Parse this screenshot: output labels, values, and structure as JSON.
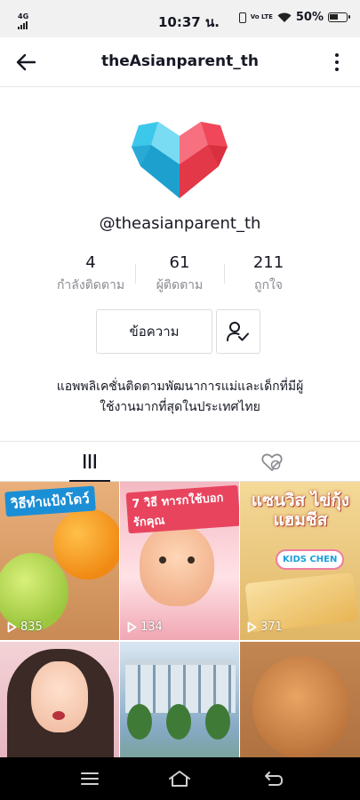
{
  "status_bar": {
    "network": "4G",
    "time": "10:37 น.",
    "volte": "Vo LTE",
    "battery": "50%"
  },
  "header": {
    "title": "theAsianparent_th",
    "back_icon": "arrow-left-icon",
    "more_icon": "more-vertical-icon"
  },
  "profile": {
    "avatar_icon": "heart-logo-icon",
    "avatar_colors": {
      "left": "#3cc8ea",
      "right": "#f0475a"
    },
    "username": "@theasianparent_th",
    "stats": [
      {
        "value": "4",
        "label": "กำลังติดตาม"
      },
      {
        "value": "61",
        "label": "ผู้ติดตาม"
      },
      {
        "value": "211",
        "label": "ถูกใจ"
      }
    ],
    "message_button": "ข้อความ",
    "follow_icon": "user-check-icon",
    "bio_line1": "แอพพลิเคชั่นติดตามพัฒนาการแม่และเด็กที่มีผู้",
    "bio_line2": "ใช้งานมากที่สุดในประเทศไทย"
  },
  "tabs": {
    "videos_icon": "grid-videos-icon",
    "liked_icon": "liked-hidden-icon"
  },
  "videos": [
    {
      "title": "วิธีทำแป้งโดว์",
      "views": "835"
    },
    {
      "title": "7 วิธี ทารกใช้บอกรักคุณ",
      "views": "134"
    },
    {
      "title": "แซนวิส ไข่กุ้งแฮมชีส",
      "badge": "KIDS CHEN",
      "views": "371"
    },
    {
      "title": ""
    },
    {
      "title": ""
    },
    {
      "title": ""
    }
  ],
  "navbar": {
    "menu_icon": "menu-icon",
    "home_icon": "home-icon",
    "back_icon": "back-icon"
  }
}
